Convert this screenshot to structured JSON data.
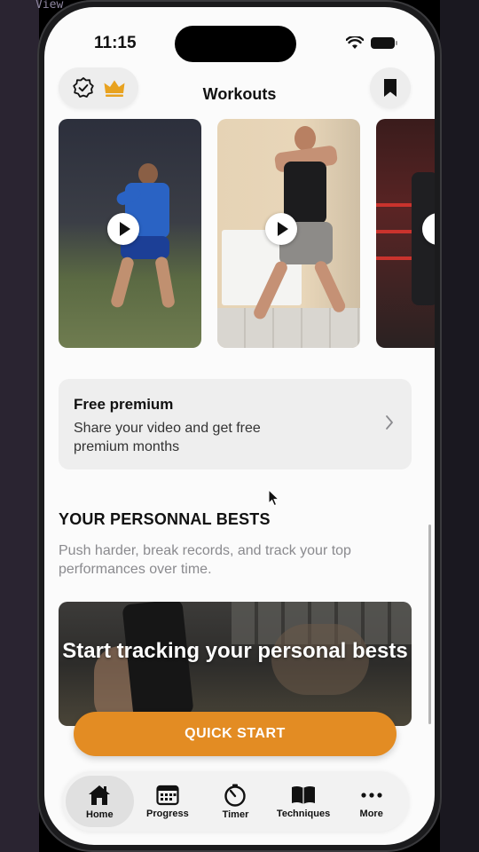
{
  "status": {
    "time": "11:15"
  },
  "background": {
    "text": "View"
  },
  "header": {
    "title": "Workouts",
    "left_icons": [
      "verified-badge-icon",
      "crown-icon"
    ],
    "right_icon": "bookmark-icon"
  },
  "videos": [
    {
      "name": "boxer-blue-shirt"
    },
    {
      "name": "boxer-black-shirt"
    },
    {
      "name": "boxer-ring"
    }
  ],
  "promo": {
    "title": "Free premium",
    "subtitle": "Share your video and get free premium months"
  },
  "personal_bests": {
    "title": "YOUR PERSONNAL BESTS",
    "subtitle": "Push harder, break records, and track your top performances over time.",
    "banner_text": "Start tracking your personal bests"
  },
  "quick_start": {
    "label": "QUICK START"
  },
  "tabs": [
    {
      "label": "Home",
      "icon": "house-icon",
      "active": true
    },
    {
      "label": "Progress",
      "icon": "calendar-icon",
      "active": false
    },
    {
      "label": "Timer",
      "icon": "stopwatch-icon",
      "active": false
    },
    {
      "label": "Techniques",
      "icon": "book-icon",
      "active": false
    },
    {
      "label": "More",
      "icon": "ellipsis-icon",
      "active": false
    }
  ],
  "colors": {
    "accent": "#e38c23",
    "crown": "#e8a21f",
    "background": "#fbfbfb"
  }
}
